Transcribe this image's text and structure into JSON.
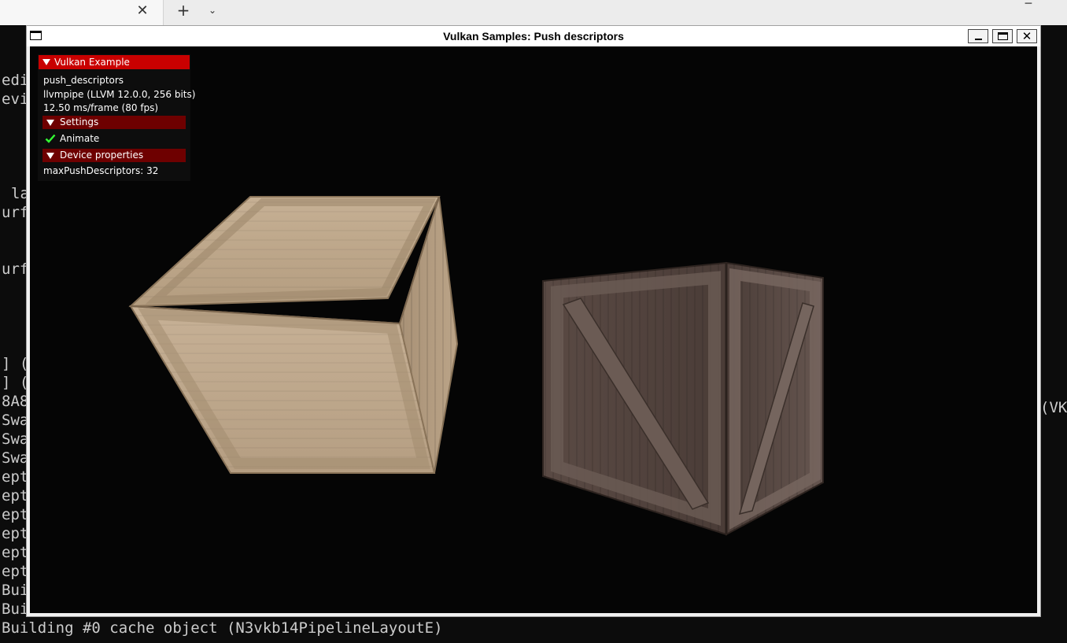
{
  "host": {
    "tab": {
      "close_icon": "close-icon"
    },
    "new_tab_icon": "plus-icon",
    "tab_dropdown_icon": "chevron-down-icon",
    "minimize_icon": "minimize-icon"
  },
  "terminal": {
    "left_fragments": [
      "edi",
      "evi",
      "",
      "",
      "la",
      "urf",
      "",
      "urf",
      "",
      "",
      "] (",
      "] (",
      "8A8",
      "Swa",
      "Swa",
      "Swa",
      "ept",
      "ept",
      "ept",
      "ept",
      "ept",
      "ept",
      "Bui",
      "Bui"
    ],
    "building_line": "Building #0 cache object (N3vkb14PipelineLayoutE)",
    "right_fragment": "(VK",
    "text_color": "#cccccc",
    "background": "#0c0c0c"
  },
  "window": {
    "title": "Vulkan Samples: Push descriptors",
    "minimize_icon": "minimize-icon",
    "maximize_icon": "maximize-icon",
    "close_icon": "close-icon"
  },
  "overlay": {
    "title": "Vulkan Example",
    "app_name": "push_descriptors",
    "device": "llvmpipe (LLVM 12.0.0, 256 bits)",
    "frame_time": "12.50 ms/frame (80 fps)",
    "settings_header": "Settings",
    "animate_label": "Animate",
    "animate_checked": true,
    "device_header": "Device properties",
    "max_push": "maxPushDescriptors: 32",
    "colors": {
      "title_bg": "#c90000",
      "header_bg": "#6e0000",
      "check": "#33ff33"
    }
  },
  "scene": {
    "objects": [
      "light-wooden-crate",
      "dark-wooden-crate"
    ],
    "background": "#050505"
  }
}
